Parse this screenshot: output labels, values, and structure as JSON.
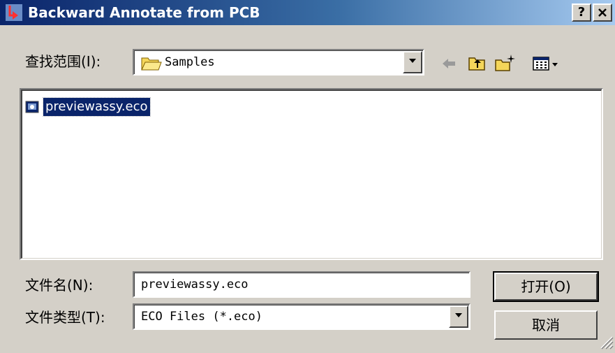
{
  "window": {
    "title": "Backward Annotate from PCB",
    "help_label": "?",
    "close_label": "✕"
  },
  "lookin": {
    "label": "查找范围(I):",
    "value": "Samples"
  },
  "toolbar": {
    "icons": [
      "back-arrow-icon",
      "up-folder-icon",
      "new-folder-icon",
      "view-menu-icon"
    ]
  },
  "files": [
    {
      "name": "previewassy.eco",
      "icon": "eco-file-icon",
      "selected": true
    }
  ],
  "filename": {
    "label": "文件名(N):",
    "value": "previewassy.eco"
  },
  "filetype": {
    "label": "文件类型(T):",
    "value": "ECO Files (*.eco)"
  },
  "buttons": {
    "open": "打开(O)",
    "cancel": "取消"
  },
  "colors": {
    "titlebar_start": "#0a246a",
    "titlebar_end": "#a6caf0",
    "face": "#d4d0c8",
    "selection": "#0a246a"
  }
}
